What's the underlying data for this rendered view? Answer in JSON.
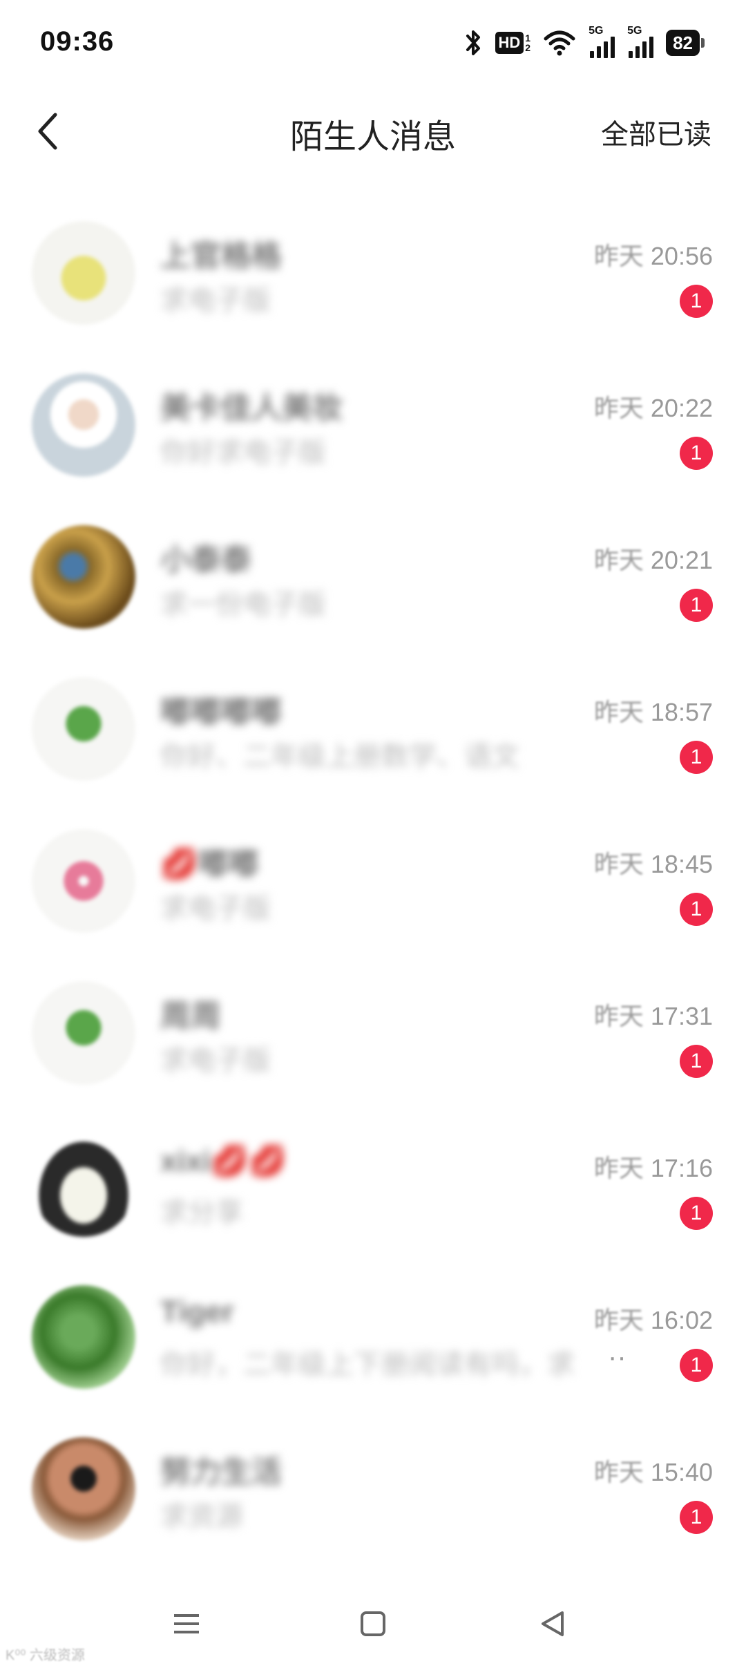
{
  "status_bar": {
    "time": "09:36",
    "hd_label": "HD",
    "hd_sub_top": "1",
    "hd_sub_bottom": "2",
    "network_1": "5G",
    "network_2": "5G",
    "battery": "82"
  },
  "header": {
    "title": "陌生人消息",
    "action": "全部已读"
  },
  "conversations": [
    {
      "name": "上官格格",
      "preview": "求电子版",
      "day": "昨天",
      "time": "20:56",
      "unread": "1",
      "avatar": "sticker-lemon",
      "avatar_color": "#e8e27a"
    },
    {
      "name": "美卡佳人美妆",
      "preview": "你好求电子版",
      "day": "昨天",
      "time": "20:22",
      "unread": "1",
      "avatar": "photo-person",
      "avatar_color": "#c9d4dc"
    },
    {
      "name": "小泰泰",
      "preview": "求一份电子版",
      "day": "昨天",
      "time": "20:21",
      "unread": "1",
      "avatar": "photo-pattern",
      "avatar_color": "#7a6a3a"
    },
    {
      "name": "嘟嘟嘟嘟",
      "preview": "你好、二年级上册数学、语文",
      "day": "昨天",
      "time": "18:57",
      "unread": "1",
      "avatar": "sticker-broccoli",
      "avatar_color": "#5aa64a"
    },
    {
      "name": "💋嘟嘟",
      "preview": "求电子版",
      "day": "昨天",
      "time": "18:45",
      "unread": "1",
      "avatar": "sticker-donut",
      "avatar_color": "#e77b9a"
    },
    {
      "name": "周周",
      "preview": "求电子版",
      "day": "昨天",
      "time": "17:31",
      "unread": "1",
      "avatar": "sticker-broccoli",
      "avatar_color": "#5aa64a"
    },
    {
      "name": "xixi💋💋",
      "preview": "求分享",
      "day": "昨天",
      "time": "17:16",
      "unread": "1",
      "avatar": "cartoon-face",
      "avatar_color": "#2a2a2a"
    },
    {
      "name": "Tiger",
      "preview": "你好，二年级上下册阅读有吗，求",
      "day": "昨天",
      "time": "16:02",
      "unread": "1",
      "avatar": "photo-leaves",
      "avatar_color": "#4a8a3a",
      "ellipsis": "··"
    },
    {
      "name": "努力生活",
      "preview": "求资源",
      "day": "昨天",
      "time": "15:40",
      "unread": "1",
      "avatar": "photo-sunglasses",
      "avatar_color": "#8a5a3a"
    }
  ],
  "watermark": "K⁰⁰ 六级资源",
  "colors": {
    "badge": "#f0284a",
    "secondary_text": "#999999"
  },
  "icons": [
    "bluetooth-icon",
    "wifi-icon",
    "signal-icon",
    "battery-icon",
    "back-arrow-icon",
    "menu-icon",
    "home-icon",
    "back-triangle-icon"
  ]
}
